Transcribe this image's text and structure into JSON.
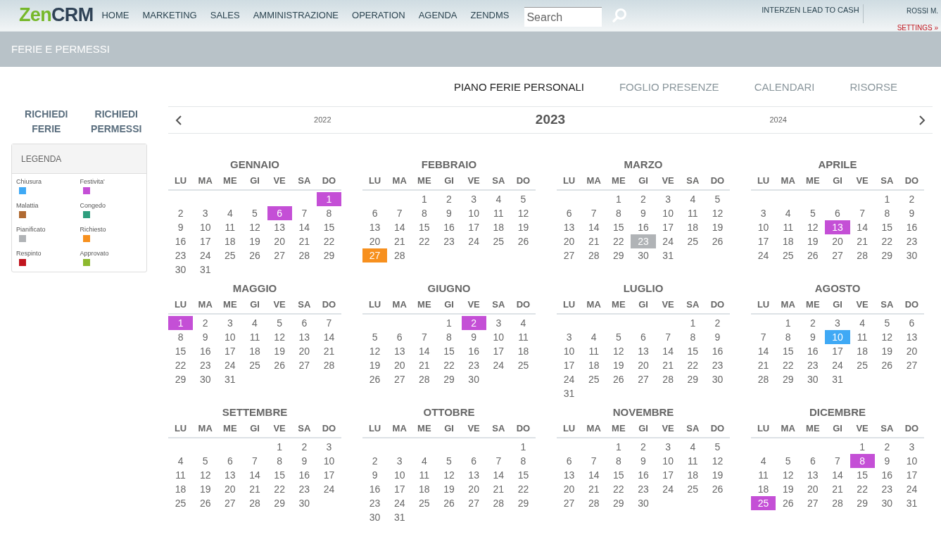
{
  "header": {
    "logo": {
      "part1": "Zen",
      "part2": "CRM"
    },
    "nav": [
      "HOME",
      "MARKETING",
      "SALES",
      "AMMINISTRAZIONE",
      "OPERATION",
      "AGENDA",
      "ZENDMS"
    ],
    "search": {
      "placeholder": "Search"
    },
    "company": "INTERZEN LEAD TO CASH",
    "user": "ROSSI M.",
    "settings": "SETTINGS »"
  },
  "page_title": "FERIE E PERMESSI",
  "tabs": [
    {
      "label": "PIANO FERIE PERSONALI",
      "selected": true
    },
    {
      "label": "FOGLIO PRESENZE",
      "selected": false
    },
    {
      "label": "CALENDARI",
      "selected": false
    },
    {
      "label": "RISORSE",
      "selected": false
    }
  ],
  "actions": [
    "RICHIEDI FERIE",
    "RICHIEDI PERMESSI"
  ],
  "legend": {
    "title": "LEGENDA",
    "items": [
      {
        "label": "Chiusura",
        "color": "#3fa9f5"
      },
      {
        "label": "Festivita'",
        "color": "#c44fd6"
      },
      {
        "label": "Malattia",
        "color": "#b06a32"
      },
      {
        "label": "Congedo",
        "color": "#2e9e7e"
      },
      {
        "label": "Pianificato",
        "color": "#b0b3b6"
      },
      {
        "label": "Richiesto",
        "color": "#f7901e"
      },
      {
        "label": "Respinto",
        "color": "#c1151f"
      },
      {
        "label": "Approvato",
        "color": "#8db92e"
      }
    ]
  },
  "year_nav": {
    "prev_year": "2022",
    "year": "2023",
    "next_year": "2024"
  },
  "months": [
    {
      "name": "GENNAIO",
      "weekdays": [
        "LU",
        "MA",
        "ME",
        "GI",
        "VE",
        "SA",
        "DO"
      ],
      "weeks": [
        [
          {
            "d": "1",
            "color": "#c44fd6"
          }
        ],
        [
          "2",
          "3",
          "4",
          "5",
          {
            "d": "6",
            "color": "#c44fd6"
          },
          "7",
          "8"
        ],
        [
          "9",
          "10",
          "11",
          "12",
          "13",
          "14",
          "15"
        ],
        [
          "16",
          "17",
          "18",
          "19",
          "20",
          "21",
          "22"
        ],
        [
          "23",
          "24",
          "25",
          "26",
          "27",
          "28",
          "29"
        ],
        [
          "30",
          "31"
        ]
      ]
    },
    {
      "name": "FEBBRAIO",
      "weekdays": [
        "LU",
        "MA",
        "ME",
        "GI",
        "VE",
        "SA",
        "DO"
      ],
      "weeks": [
        [
          "1",
          "2",
          "3",
          "4",
          "5"
        ],
        [
          "6",
          "7",
          "8",
          "9",
          "10",
          "11",
          "12"
        ],
        [
          "13",
          "14",
          "15",
          "16",
          "17",
          "18",
          "19"
        ],
        [
          "20",
          "21",
          "22",
          "23",
          "24",
          "25",
          "26"
        ],
        [
          {
            "d": "27",
            "color": "#f7901e"
          },
          "28"
        ]
      ]
    },
    {
      "name": "MARZO",
      "weekdays": [
        "LU",
        "MA",
        "ME",
        "GI",
        "VE",
        "SA",
        "DO"
      ],
      "weeks": [
        [
          "1",
          "2",
          "3",
          "4",
          "5"
        ],
        [
          "6",
          "7",
          "8",
          "9",
          "10",
          "11",
          "12"
        ],
        [
          "13",
          "14",
          "15",
          "16",
          "17",
          "18",
          "19"
        ],
        [
          "20",
          "21",
          "22",
          {
            "d": "23",
            "color": "#b0b3b6"
          },
          "24",
          "25",
          "26"
        ],
        [
          "27",
          "28",
          "29",
          "30",
          "31"
        ]
      ]
    },
    {
      "name": "APRILE",
      "weekdays": [
        "LU",
        "MA",
        "ME",
        "GI",
        "VE",
        "SA",
        "DO"
      ],
      "weeks": [
        [
          "1",
          "2"
        ],
        [
          "3",
          "4",
          "5",
          "6",
          "7",
          "8",
          "9"
        ],
        [
          "10",
          "11",
          "12",
          {
            "d": "13",
            "color": "#c44fd6"
          },
          "14",
          "15",
          "16"
        ],
        [
          "17",
          "18",
          "19",
          "20",
          "21",
          "22",
          "23"
        ],
        [
          "24",
          "25",
          "26",
          "27",
          "28",
          "29",
          "30"
        ]
      ]
    },
    {
      "name": "MAGGIO",
      "weekdays": [
        "LU",
        "MA",
        "ME",
        "GI",
        "VE",
        "SA",
        "DO"
      ],
      "weeks": [
        [
          {
            "d": "1",
            "color": "#c44fd6"
          },
          "2",
          "3",
          "4",
          "5",
          "6",
          "7"
        ],
        [
          "8",
          "9",
          "10",
          "11",
          "12",
          "13",
          "14"
        ],
        [
          "15",
          "16",
          "17",
          "18",
          "19",
          "20",
          "21"
        ],
        [
          "22",
          "23",
          "24",
          "25",
          "26",
          "27",
          "28"
        ],
        [
          "29",
          "30",
          "31"
        ]
      ]
    },
    {
      "name": "GIUGNO",
      "weekdays": [
        "LU",
        "MA",
        "ME",
        "GI",
        "VE",
        "SA",
        "DO"
      ],
      "weeks": [
        [
          "1",
          {
            "d": "2",
            "color": "#c44fd6"
          },
          "3",
          "4"
        ],
        [
          "5",
          "6",
          "7",
          "8",
          "9",
          "10",
          "11"
        ],
        [
          "12",
          "13",
          "14",
          "15",
          "16",
          "17",
          "18"
        ],
        [
          "19",
          "20",
          "21",
          "22",
          "23",
          "24",
          "25"
        ],
        [
          "26",
          "27",
          "28",
          "29",
          "30"
        ]
      ]
    },
    {
      "name": "LUGLIO",
      "weekdays": [
        "LU",
        "MA",
        "ME",
        "GI",
        "VE",
        "SA",
        "DO"
      ],
      "weeks": [
        [
          "1",
          "2"
        ],
        [
          "3",
          "4",
          "5",
          "6",
          "7",
          "8",
          "9"
        ],
        [
          "10",
          "11",
          "12",
          "13",
          "14",
          "15",
          "16"
        ],
        [
          "17",
          "18",
          "19",
          "20",
          "21",
          "22",
          "23"
        ],
        [
          "24",
          "25",
          "26",
          "27",
          "28",
          "29",
          "30"
        ],
        [
          "31"
        ]
      ]
    },
    {
      "name": "AGOSTO",
      "weekdays": [
        "LU",
        "MA",
        "ME",
        "GI",
        "VE",
        "SA",
        "DO"
      ],
      "weeks": [
        [
          "1",
          "2",
          "3",
          "4",
          "5",
          "6"
        ],
        [
          "7",
          "8",
          "9",
          {
            "d": "10",
            "color": "#3fa9f5"
          },
          "11",
          "12",
          "13"
        ],
        [
          "14",
          "15",
          "16",
          "17",
          "18",
          "19",
          "20"
        ],
        [
          "21",
          "22",
          "23",
          "24",
          "25",
          "26",
          "27"
        ],
        [
          "28",
          "29",
          "30",
          "31"
        ]
      ]
    },
    {
      "name": "SETTEMBRE",
      "weekdays": [
        "LU",
        "MA",
        "ME",
        "GI",
        "VE",
        "SA",
        "DO"
      ],
      "weeks": [
        [
          "1",
          "2",
          "3"
        ],
        [
          "4",
          "5",
          "6",
          "7",
          "8",
          "9",
          "10"
        ],
        [
          "11",
          "12",
          "13",
          "14",
          "15",
          "16",
          "17"
        ],
        [
          "18",
          "19",
          "20",
          "21",
          "22",
          "23",
          "24"
        ],
        [
          "25",
          "26",
          "27",
          "28",
          "29",
          "30"
        ]
      ]
    },
    {
      "name": "OTTOBRE",
      "weekdays": [
        "LU",
        "MA",
        "ME",
        "GI",
        "VE",
        "SA",
        "DO"
      ],
      "weeks": [
        [
          "1"
        ],
        [
          "2",
          "3",
          "4",
          "5",
          "6",
          "7",
          "8"
        ],
        [
          "9",
          "10",
          "11",
          "12",
          "13",
          "14",
          "15"
        ],
        [
          "16",
          "17",
          "18",
          "19",
          "20",
          "21",
          "22"
        ],
        [
          "23",
          "24",
          "25",
          "26",
          "27",
          "28",
          "29"
        ],
        [
          "30",
          "31"
        ]
      ]
    },
    {
      "name": "NOVEMBRE",
      "weekdays": [
        "LU",
        "MA",
        "ME",
        "GI",
        "VE",
        "SA",
        "DO"
      ],
      "weeks": [
        [
          "1",
          "2",
          "3",
          "4",
          "5"
        ],
        [
          "6",
          "7",
          "8",
          "9",
          "10",
          "11",
          "12"
        ],
        [
          "13",
          "14",
          "15",
          "16",
          "17",
          "18",
          "19"
        ],
        [
          "20",
          "21",
          "22",
          "23",
          "24",
          "25",
          "26"
        ],
        [
          "27",
          "28",
          "29",
          "30"
        ]
      ]
    },
    {
      "name": "DICEMBRE",
      "weekdays": [
        "LU",
        "MA",
        "ME",
        "GI",
        "VE",
        "SA",
        "DO"
      ],
      "weeks": [
        [
          "1",
          "2",
          "3"
        ],
        [
          "4",
          "5",
          "6",
          "7",
          {
            "d": "8",
            "color": "#c44fd6"
          },
          "9",
          "10"
        ],
        [
          "11",
          "12",
          "13",
          "14",
          "15",
          "16",
          "17"
        ],
        [
          "18",
          "19",
          "20",
          "21",
          "22",
          "23",
          "24"
        ],
        [
          {
            "d": "25",
            "color": "#c44fd6"
          },
          "26",
          "27",
          "28",
          "29",
          "30",
          "31"
        ]
      ]
    }
  ]
}
